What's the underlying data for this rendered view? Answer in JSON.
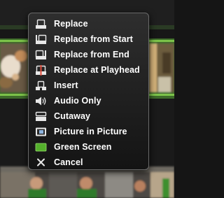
{
  "menu": {
    "items": [
      {
        "label": "Replace",
        "icon": "replace-icon"
      },
      {
        "label": "Replace from Start",
        "icon": "replace-from-start-icon"
      },
      {
        "label": "Replace from End",
        "icon": "replace-from-end-icon"
      },
      {
        "label": "Replace at Playhead",
        "icon": "replace-at-playhead-icon"
      },
      {
        "label": "Insert",
        "icon": "insert-icon"
      },
      {
        "label": "Audio Only",
        "icon": "speaker-icon"
      },
      {
        "label": "Cutaway",
        "icon": "cutaway-icon"
      },
      {
        "label": "Picture in Picture",
        "icon": "picture-in-picture-icon"
      },
      {
        "label": "Green Screen",
        "icon": "green-screen-icon"
      },
      {
        "label": "Cancel",
        "icon": "cancel-icon"
      }
    ]
  },
  "colors": {
    "timeline_border": "#7cc34a",
    "green_screen": "#54b02c",
    "menu_background": "#222222"
  }
}
